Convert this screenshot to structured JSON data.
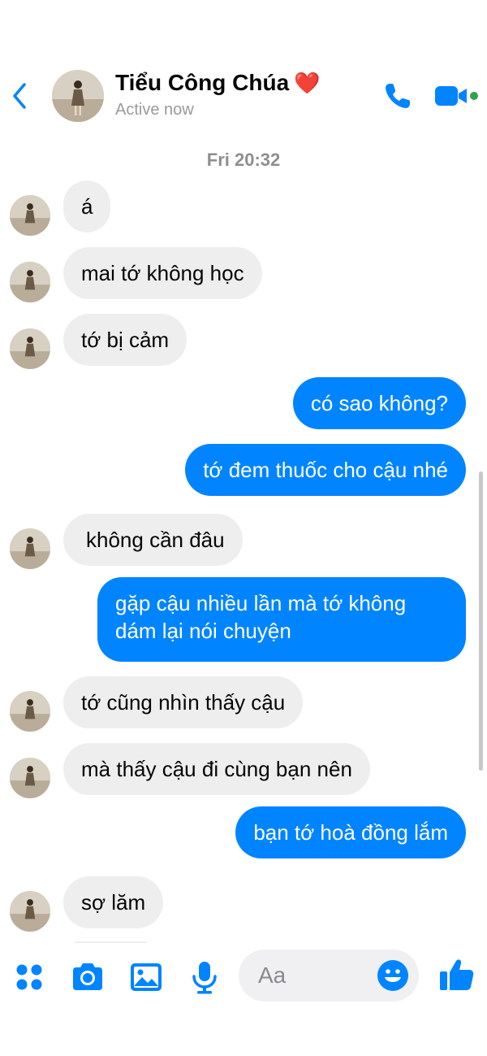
{
  "header": {
    "contact_name": "Tiểu Công Chúa",
    "heart": "❤️",
    "status": "Active now"
  },
  "timestamp": "Fri 20:32",
  "messages": [
    {
      "from": "them",
      "text": "á"
    },
    {
      "from": "them",
      "text": "mai tớ không học"
    },
    {
      "from": "them",
      "text": "tớ bị cảm"
    },
    {
      "from": "me",
      "text": "có sao không?"
    },
    {
      "from": "me",
      "text": "tớ đem thuốc cho cậu nhé"
    },
    {
      "from": "them",
      "text": "không cần đâu"
    },
    {
      "from": "me",
      "text": "gặp cậu nhiều lần mà tớ không dám lại nói chuyện"
    },
    {
      "from": "them",
      "text": "tớ cũng nhìn thấy cậu"
    },
    {
      "from": "them",
      "text": "mà thấy cậu đi cùng bạn nên"
    },
    {
      "from": "me",
      "text": "bạn tớ hoà đồng lắm"
    },
    {
      "from": "them",
      "text": "sợ lăm"
    }
  ],
  "composer": {
    "placeholder": "Aa"
  },
  "icons": {
    "back": "chevron-left-icon",
    "call": "phone-icon",
    "video": "video-camera-icon",
    "menu": "four-dots-icon",
    "camera": "camera-icon",
    "gallery": "image-icon",
    "mic": "microphone-icon",
    "emoji": "smiley-icon",
    "like": "thumbs-up-icon"
  },
  "colors": {
    "accent": "#0084ff",
    "incoming_bubble": "#eeeeef",
    "online_dot": "#31a24c"
  }
}
